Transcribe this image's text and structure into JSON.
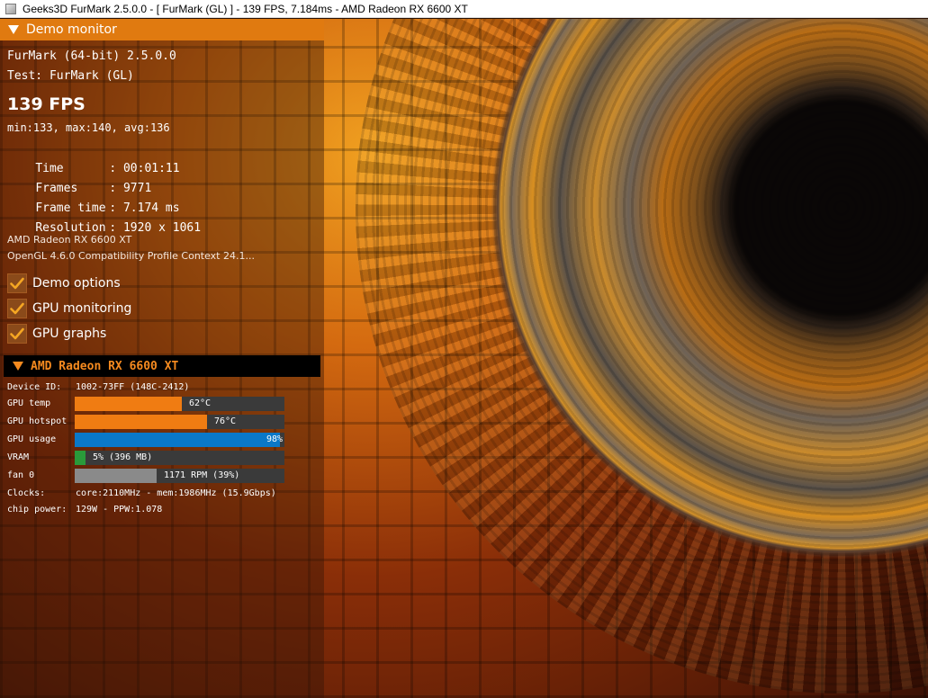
{
  "window": {
    "title": "Geeks3D FurMark 2.5.0.0 - [ FurMark (GL) ] - 139 FPS, 7.184ms - AMD Radeon RX 6600 XT",
    "icon": "app-window-icon"
  },
  "panel": {
    "header": "Demo monitor",
    "app_name": "FurMark (64-bit) 2.5.0.0",
    "test": "Test: FurMark (GL)",
    "fps": "139 FPS",
    "fps_stats": "min:133, max:140, avg:136",
    "stats": [
      {
        "key": "Time",
        "value": ": 00:01:11"
      },
      {
        "key": "Frames",
        "value": ": 9771"
      },
      {
        "key": "Frame time",
        "value": ": 7.174 ms"
      },
      {
        "key": "Resolution",
        "value": ": 1920 x 1061"
      }
    ],
    "gpu_name": "AMD Radeon RX 6600 XT",
    "opengl": "OpenGL 4.6.0 Compatibility Profile Context 24.1...",
    "checkboxes": [
      {
        "label": "Demo options",
        "checked": true
      },
      {
        "label": "GPU monitoring",
        "checked": true
      },
      {
        "label": "GPU graphs",
        "checked": true
      }
    ]
  },
  "gpu": {
    "header": "AMD Radeon RX 6600 XT",
    "device_id_label": "Device ID:",
    "device_id": "1002-73FF (148C-2412)",
    "metrics": [
      {
        "label": "GPU temp",
        "text": "62°C",
        "fraction": 0.51,
        "color": "#f07c12"
      },
      {
        "label": "GPU hotspot",
        "text": "76°C",
        "fraction": 0.63,
        "color": "#f07c12"
      },
      {
        "label": "GPU usage",
        "text": "98%",
        "fraction": 0.98,
        "color": "#0a78c8"
      },
      {
        "label": "VRAM",
        "text": "5% (396 MB)",
        "fraction": 0.05,
        "color": "#2a9a3a"
      },
      {
        "label": "fan 0",
        "text": "1171 RPM (39%)",
        "fraction": 0.39,
        "color": "#8a8a8a"
      }
    ],
    "clocks_label": "Clocks:",
    "clocks": "core:2110MHz - mem:1986MHz (15.9Gbps)",
    "power_label": "chip power:",
    "power": "129W - PPW:1.078"
  },
  "colors": {
    "accent": "#e07a10",
    "gpu_header_text": "#f58a1f",
    "check": "#f5a623"
  }
}
